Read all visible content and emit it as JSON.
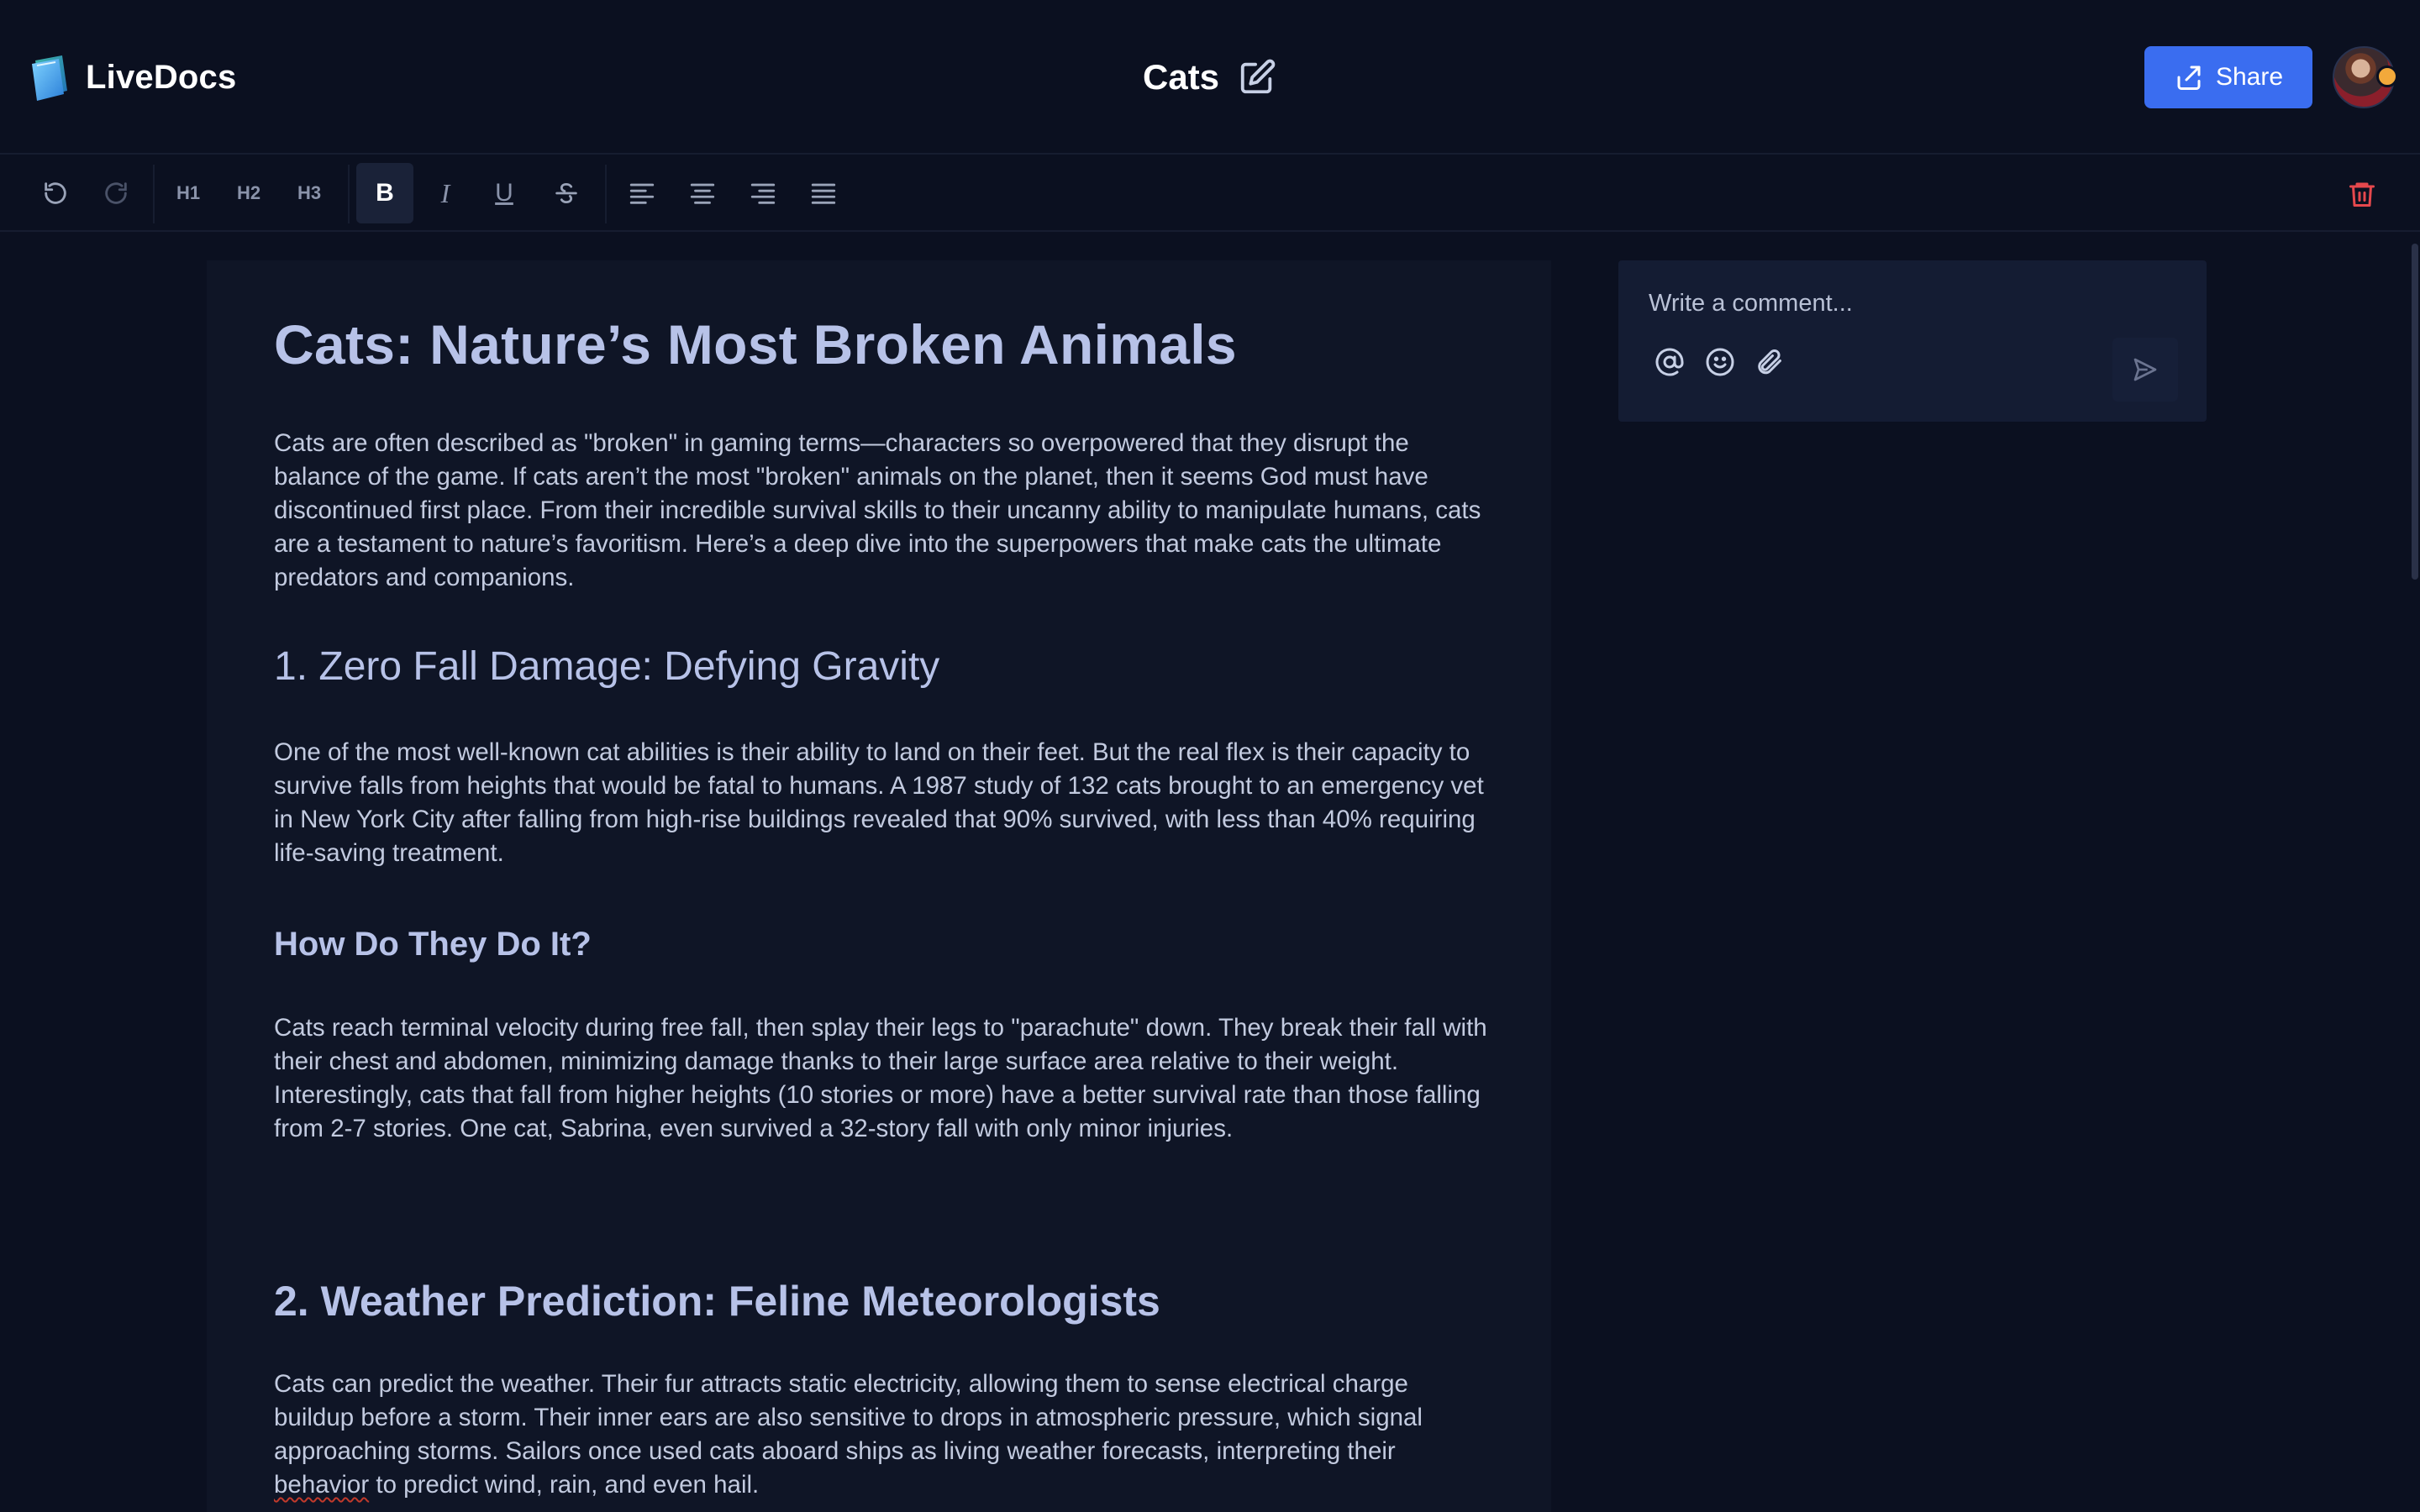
{
  "app": {
    "name": "LiveDocs"
  },
  "header": {
    "doc_title": "Cats",
    "share_label": "Share"
  },
  "toolbar": {
    "h1": "H1",
    "h2": "H2",
    "h3": "H3",
    "bold": "B",
    "italic": "I",
    "underline": "U"
  },
  "document": {
    "title": "Cats: Nature’s Most Broken Animals",
    "intro": "Cats are often described as \"broken\" in gaming terms—characters so overpowered that they disrupt the balance of the game. If cats aren’t the most \"broken\" animals on the planet, then it seems God must have discontinued first place. From their incredible survival skills to their uncanny ability to manipulate humans, cats are a testament to nature’s favoritism. Here’s a deep dive into the superpowers that make cats the ultimate predators and companions.",
    "section1_heading": "1. Zero Fall Damage: Defying Gravity",
    "section1_para": "One of the most well-known cat abilities is their ability to land on their feet. But the real flex is their capacity to survive falls from heights that would be fatal to humans. A 1987 study of 132 cats brought to an emergency vet in New York City after falling from high-rise buildings revealed that 90% survived, with less than 40% requiring life-saving treatment.",
    "subheading": "How Do They Do It?",
    "sub_para": "Cats reach terminal velocity during free fall, then splay their legs to \"parachute\" down. They break their fall with their chest and abdomen, minimizing damage thanks to their large surface area relative to their weight. Interestingly, cats that fall from higher heights (10 stories or more) have a better survival rate than those falling from 2-7 stories. One cat, Sabrina, even survived a 32-story fall with only minor injuries.",
    "section2_heading": "2. Weather Prediction: Feline Meteorologists",
    "section2_para_before": "Cats can predict the weather. Their fur attracts static electricity, allowing them to sense electrical charge buildup before a storm. Their inner ears are also sensitive to drops in atmospheric pressure, which signal approaching storms. Sailors once used cats aboard ships as living weather forecasts, interpreting their ",
    "section2_para_misspelled": "behavior",
    "section2_para_after": " to predict wind, rain, and even hail."
  },
  "comment": {
    "placeholder": "Write a comment..."
  },
  "colors": {
    "background": "#0b1020",
    "editor_bg": "#0f1526",
    "accent": "#3a6df0",
    "delete": "#e5484d",
    "heading": "#b7c2e8"
  },
  "icons": {
    "logo": "folder-logo-icon",
    "edit": "edit-icon",
    "share": "share-icon",
    "undo": "undo-icon",
    "redo": "redo-icon",
    "strikethrough": "strikethrough-icon",
    "align_left": "align-left-icon",
    "align_center": "align-center-icon",
    "align_right": "align-right-icon",
    "align_justify": "align-justify-icon",
    "delete": "trash-icon",
    "mention": "at-sign-icon",
    "emoji": "smiley-icon",
    "attach": "paperclip-icon",
    "send": "send-icon"
  }
}
